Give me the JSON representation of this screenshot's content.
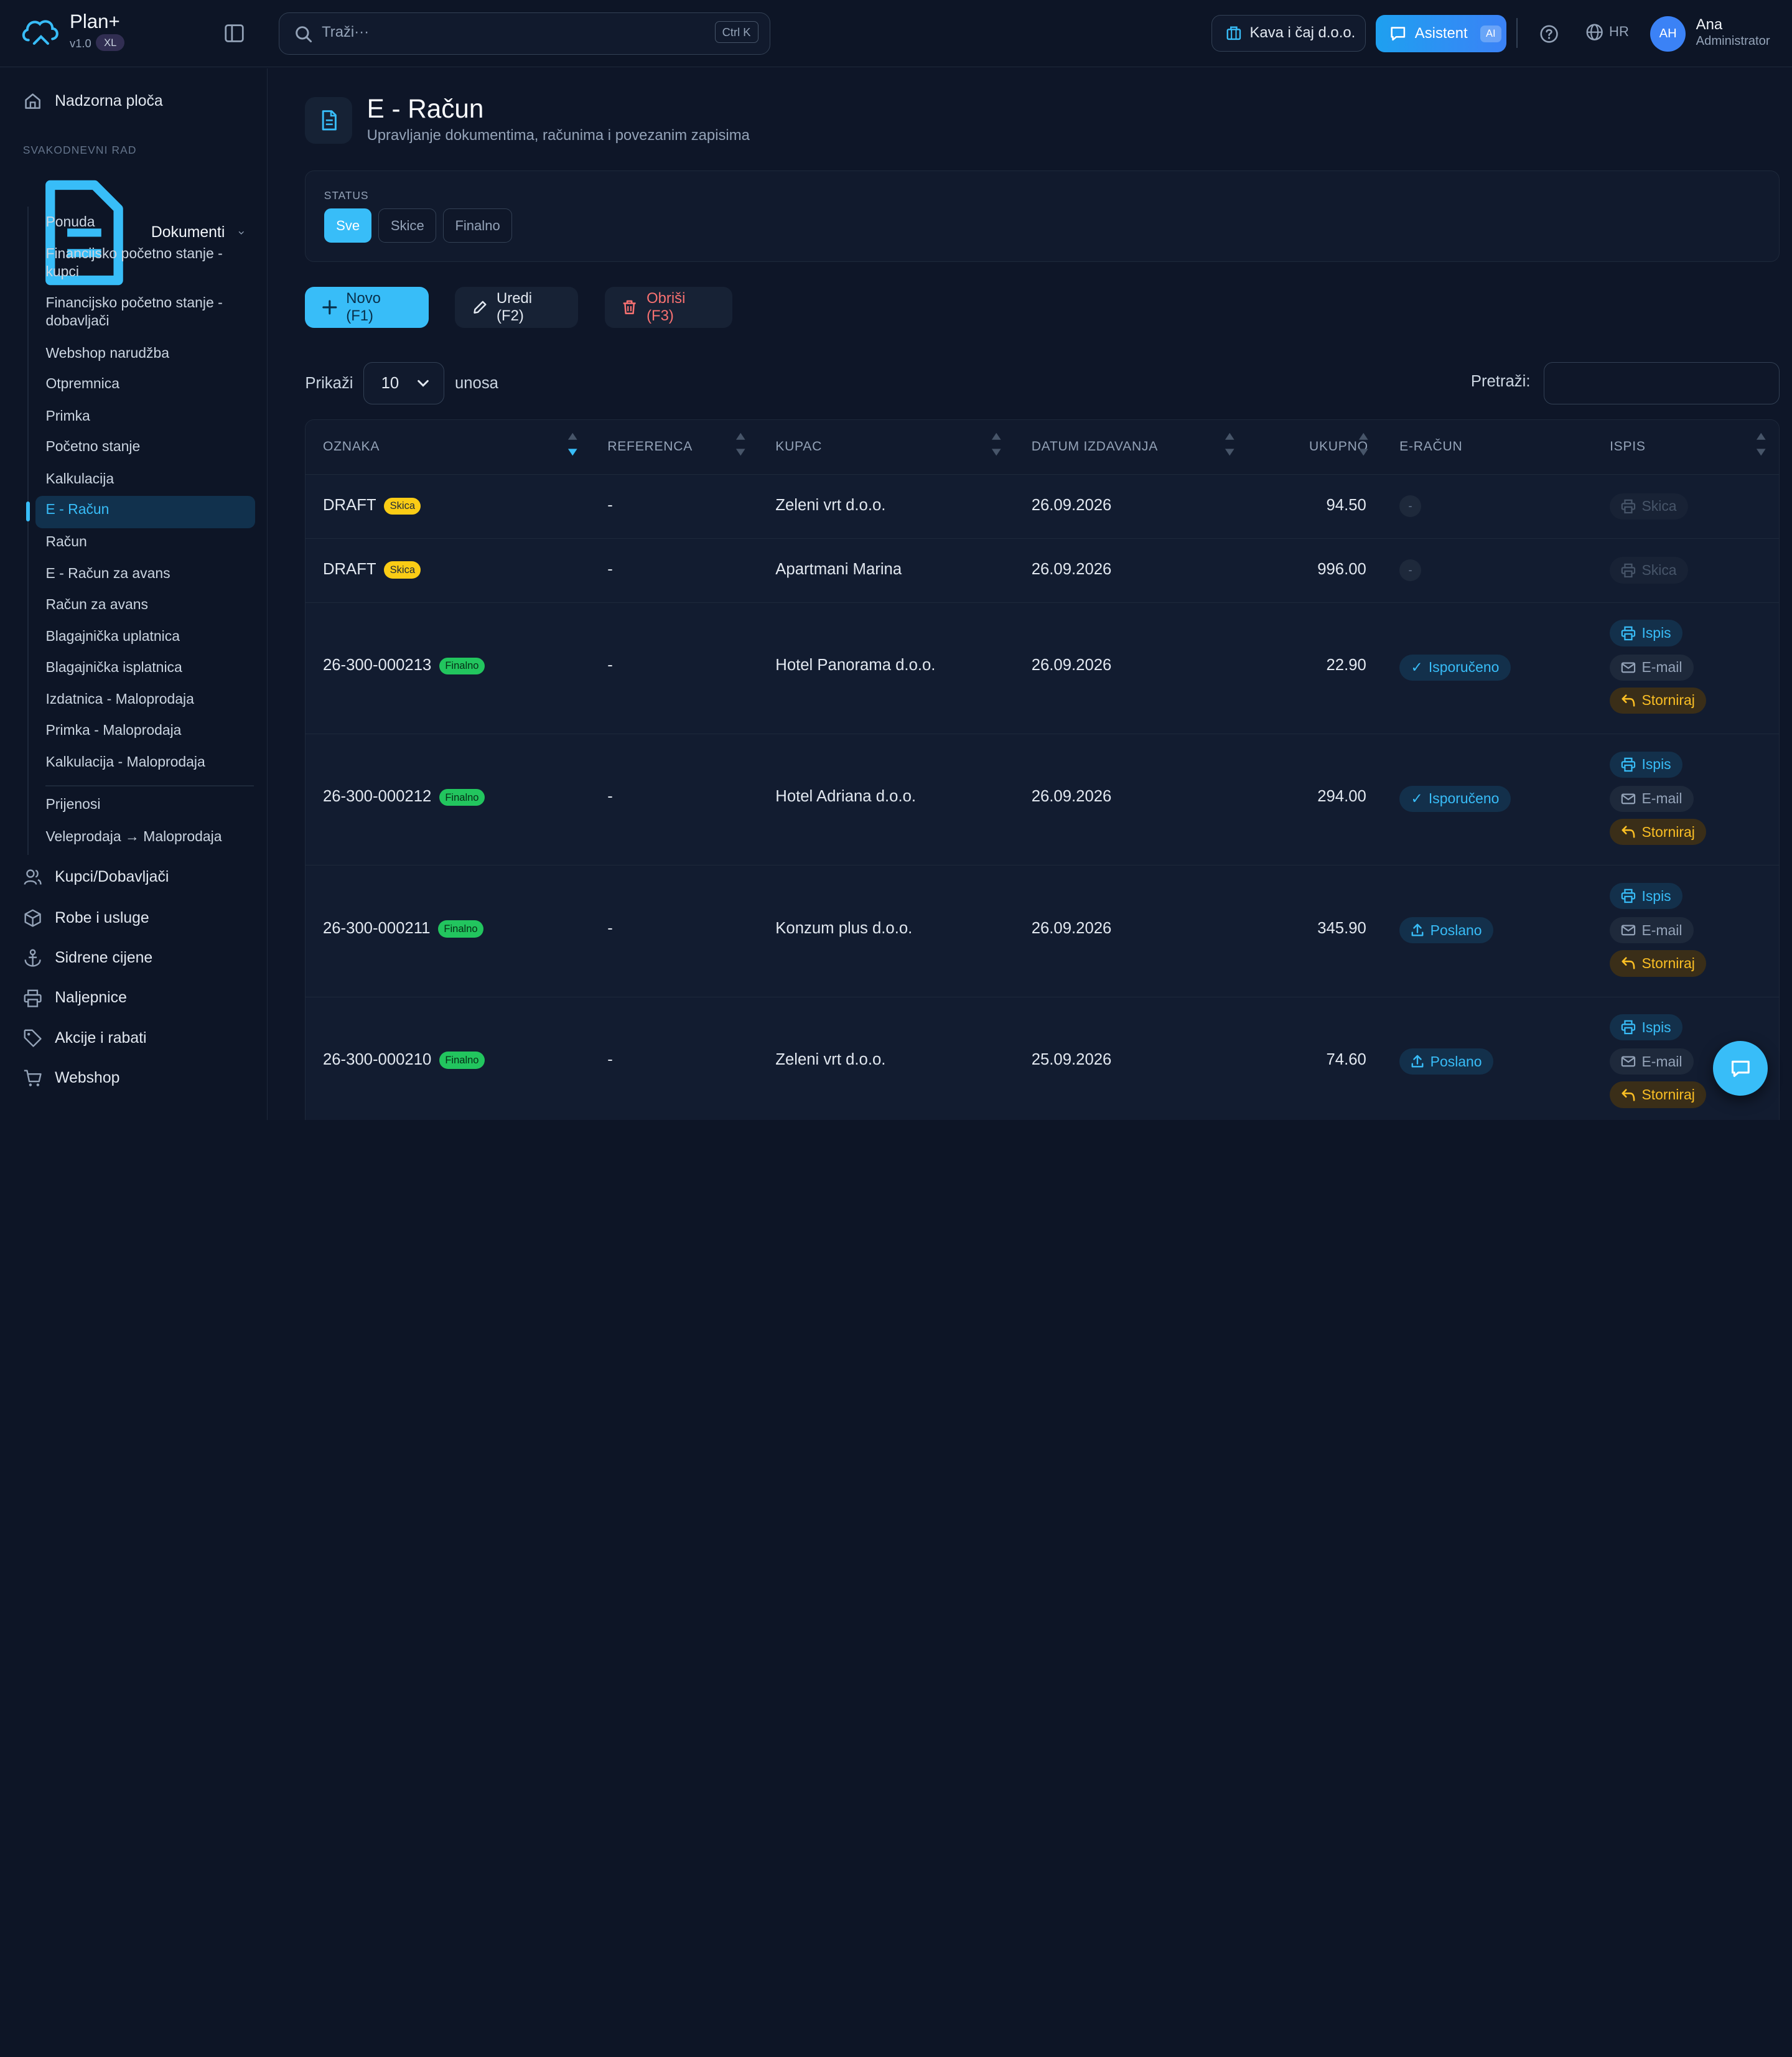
{
  "app": {
    "name": "Plan+",
    "version": "v1.0",
    "plan_badge": "XL"
  },
  "search": {
    "placeholder": "Traži···",
    "shortcut": "Ctrl K"
  },
  "header": {
    "company": "Kava i čaj d.o.o.",
    "assistant_label": "Asistent",
    "assistant_badge": "AI",
    "language": "HR",
    "user": {
      "initials": "AH",
      "name": "Ana",
      "role": "Administrator"
    }
  },
  "sidebar": {
    "dashboard": "Nadzorna ploča",
    "section_label": "SVAKODNEVNI RAD",
    "documents": "Dokumenti",
    "sub_items": [
      "Ponuda",
      "Financijsko početno stanje - kupci",
      "Financijsko početno stanje - dobavljači",
      "Webshop narudžba",
      "Otpremnica",
      "Primka",
      "Početno stanje",
      "Kalkulacija",
      "E - Račun",
      "Račun",
      "E - Račun za avans",
      "Račun za avans",
      "Blagajnička uplatnica",
      "Blagajnička isplatnica",
      "Izdatnica - Maloprodaja",
      "Primka - Maloprodaja",
      "Kalkulacija - Maloprodaja",
      "Prijenosi",
      "Veleprodaja → Maloprodaja"
    ],
    "main_items": [
      "Kupci/Dobavljači",
      "Robe i usluge",
      "Sidrene cijene",
      "Naljepnice",
      "Akcije i rabati",
      "Webshop"
    ]
  },
  "page": {
    "title": "E - Račun",
    "subtitle": "Upravljanje dokumentima, računima i povezanim zapisima",
    "status_label": "STATUS",
    "status_chips": [
      "Sve",
      "Skice",
      "Finalno"
    ],
    "status_selected": "Sve"
  },
  "toolbar": {
    "new_label": "Novo (F1)",
    "edit_label": "Uredi (F2)",
    "delete_label": "Obriši (F3)"
  },
  "table_controls": {
    "show_label": "Prikaži",
    "page_size": "10",
    "entries_label": "unosa",
    "search_label": "Pretraži:"
  },
  "table": {
    "columns": [
      "OZNAKA",
      "REFERENCA",
      "KUPAC",
      "DATUM IZDAVANJA",
      "UKUPNO",
      "E-RAČUN",
      "ISPIS"
    ],
    "rows": [
      {
        "oznaka": "DRAFT",
        "badge": "Skica",
        "referenca": "-",
        "kupac": "Zeleni vrt d.o.o.",
        "datum": "26.09.2026",
        "ukupno": "94.50",
        "eracun": "-"
      },
      {
        "oznaka": "DRAFT",
        "badge": "Skica",
        "referenca": "-",
        "kupac": "Apartmani Marina",
        "datum": "26.09.2026",
        "ukupno": "996.00",
        "eracun": "-"
      },
      {
        "oznaka": "26-300-000213",
        "badge": "Finalno",
        "referenca": "-",
        "kupac": "Hotel Panorama d.o.o.",
        "datum": "26.09.2026",
        "ukupno": "22.90",
        "eracun": "Isporučeno"
      },
      {
        "oznaka": "26-300-000212",
        "badge": "Finalno",
        "referenca": "-",
        "kupac": "Hotel Adriana d.o.o.",
        "datum": "26.09.2026",
        "ukupno": "294.00",
        "eracun": "Isporučeno"
      },
      {
        "oznaka": "26-300-000211",
        "badge": "Finalno",
        "referenca": "-",
        "kupac": "Konzum plus d.o.o.",
        "datum": "26.09.2026",
        "ukupno": "345.90",
        "eracun": "Poslano"
      },
      {
        "oznaka": "26-300-000210",
        "badge": "Finalno",
        "referenca": "-",
        "kupac": "Zeleni vrt d.o.o.",
        "datum": "25.09.2026",
        "ukupno": "74.60",
        "eracun": "Poslano"
      }
    ],
    "print_actions": {
      "skica": "Skica",
      "ispis": "Ispis",
      "email": "E-mail",
      "storno": "Storniraj"
    }
  }
}
